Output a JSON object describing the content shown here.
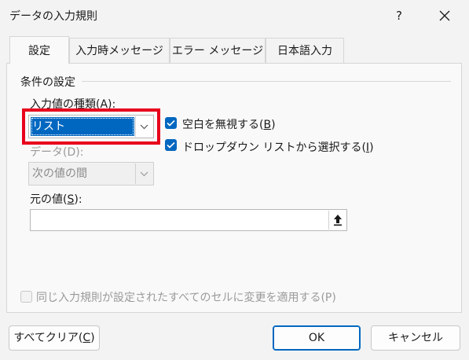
{
  "window": {
    "title": "データの入力規則",
    "help_label": "?"
  },
  "tabs": [
    {
      "label": "設定",
      "active": true
    },
    {
      "label": "入力時メッセージ",
      "active": false
    },
    {
      "label": "エラー メッセージ",
      "active": false
    },
    {
      "label": "日本語入力",
      "active": false
    }
  ],
  "criteria": {
    "group_title": "条件の設定",
    "allow_label": "入力値の種類(A):",
    "allow_value": "リスト",
    "data_label": "データ(D):",
    "data_value": "次の値の間",
    "ignore_blank": {
      "label": "空白を無視する(",
      "key": "B",
      "suffix": ")",
      "checked": true
    },
    "in_cell_dropdown": {
      "label": "ドロップダウン リストから選択する(",
      "key": "I",
      "suffix": ")",
      "checked": true
    },
    "source_label": "元の値(",
    "source_key": "S",
    "source_suffix": "):",
    "source_value": "",
    "apply_all": {
      "label": "同じ入力規則が設定されたすべてのセルに変更を適用する(P)",
      "checked": false,
      "enabled": false
    }
  },
  "buttons": {
    "clear_all_prefix": "すべてクリア(",
    "clear_all_key": "C",
    "clear_all_suffix": ")",
    "ok": "OK",
    "cancel": "キャンセル"
  },
  "colors": {
    "accent": "#0067c0",
    "highlight_border": "#e8001c"
  }
}
